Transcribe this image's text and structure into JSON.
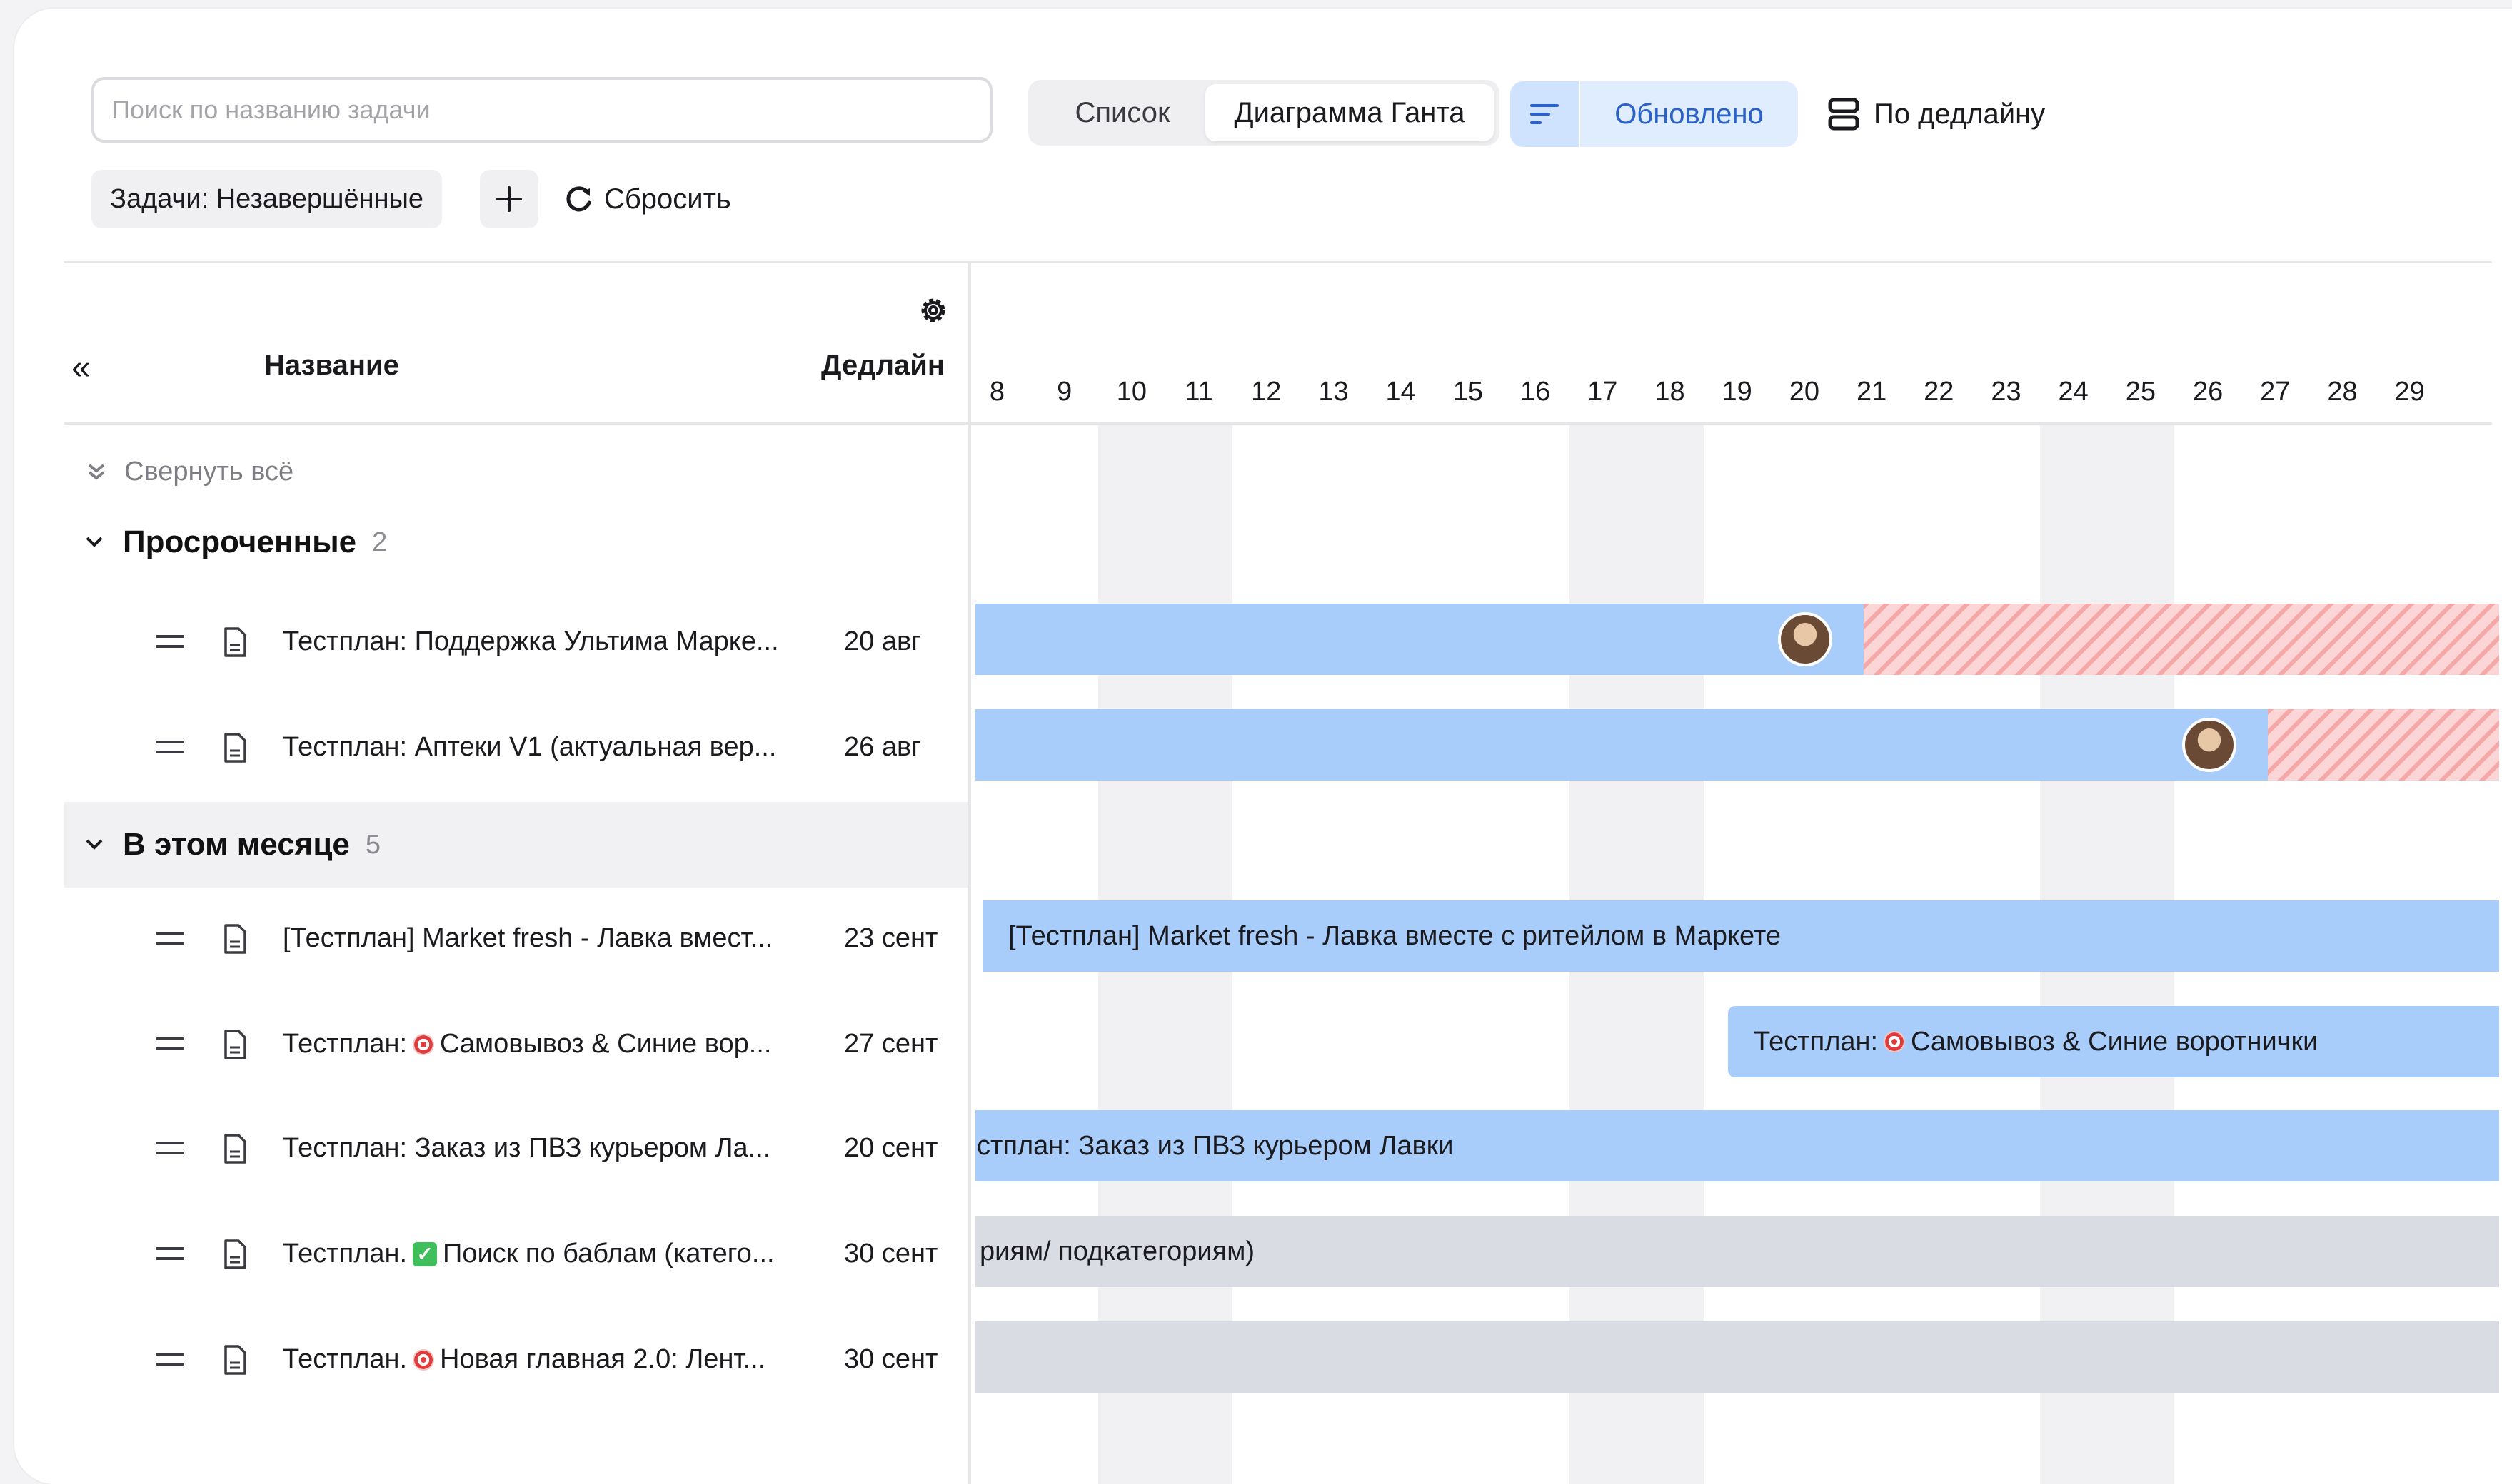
{
  "toolbar": {
    "search_placeholder": "Поиск по названию задачи",
    "view_list": "Список",
    "view_gantt": "Диаграмма Ганта",
    "sort_label": "Обновлено",
    "deadline_sort": "По дедлайну",
    "filter_chip": "Задачи: Незавершённые",
    "reset": "Сбросить"
  },
  "table": {
    "collapse_panel": "«",
    "col_name": "Название",
    "col_deadline": "Дедлайн",
    "collapse_all": "Свернуть всё"
  },
  "days": [
    "8",
    "9",
    "10",
    "11",
    "12",
    "13",
    "14",
    "15",
    "16",
    "17",
    "18",
    "19",
    "20",
    "21",
    "22",
    "23",
    "24",
    "25",
    "26",
    "27",
    "28",
    "29"
  ],
  "groups": [
    {
      "title": "Просроченные",
      "count": "2",
      "tasks": [
        {
          "title": "Тестплан: Поддержка Ультима Марке...",
          "deadline": "20 авг",
          "bar_text": ""
        },
        {
          "title": "Тестплан: Аптеки V1 (актуальная вер...",
          "deadline": "26 авг",
          "bar_text": ""
        }
      ]
    },
    {
      "title": "В этом месяце",
      "count": "5",
      "tasks": [
        {
          "title": "[Тестплан] Market fresh - Лавка вмест...",
          "deadline": "23 сент",
          "bar_text": "[Тестплан] Market fresh - Лавка вместе с ритейлом в Маркете"
        },
        {
          "title_prefix": "Тестплан:",
          "emoji": "target",
          "title": "Самовывоз & Синие вор...",
          "deadline": "27 сент",
          "bar_prefix": "Тестплан:",
          "bar_text": "Самовывоз & Синие воротнички"
        },
        {
          "title": "Тестплан: Заказ из ПВЗ курьером Ла...",
          "deadline": "20 сент",
          "bar_text": "стплан: Заказ из ПВЗ курьером Лавки"
        },
        {
          "title_prefix": "Тестплан.",
          "emoji": "check",
          "title": "Поиск по баблам (катего...",
          "deadline": "30 сент",
          "bar_text": "риям/ подкатегориям)"
        },
        {
          "title_prefix": "Тестплан.",
          "emoji": "target",
          "title": "Новая главная 2.0: Лент...",
          "deadline": "30 сент",
          "bar_text": ""
        }
      ]
    }
  ],
  "colors": {
    "bar_blue": "#a8cdfa",
    "bar_grey": "#d9dde3",
    "overdue_hatch": "#f6a7a7",
    "accent": "#2a62c9"
  }
}
